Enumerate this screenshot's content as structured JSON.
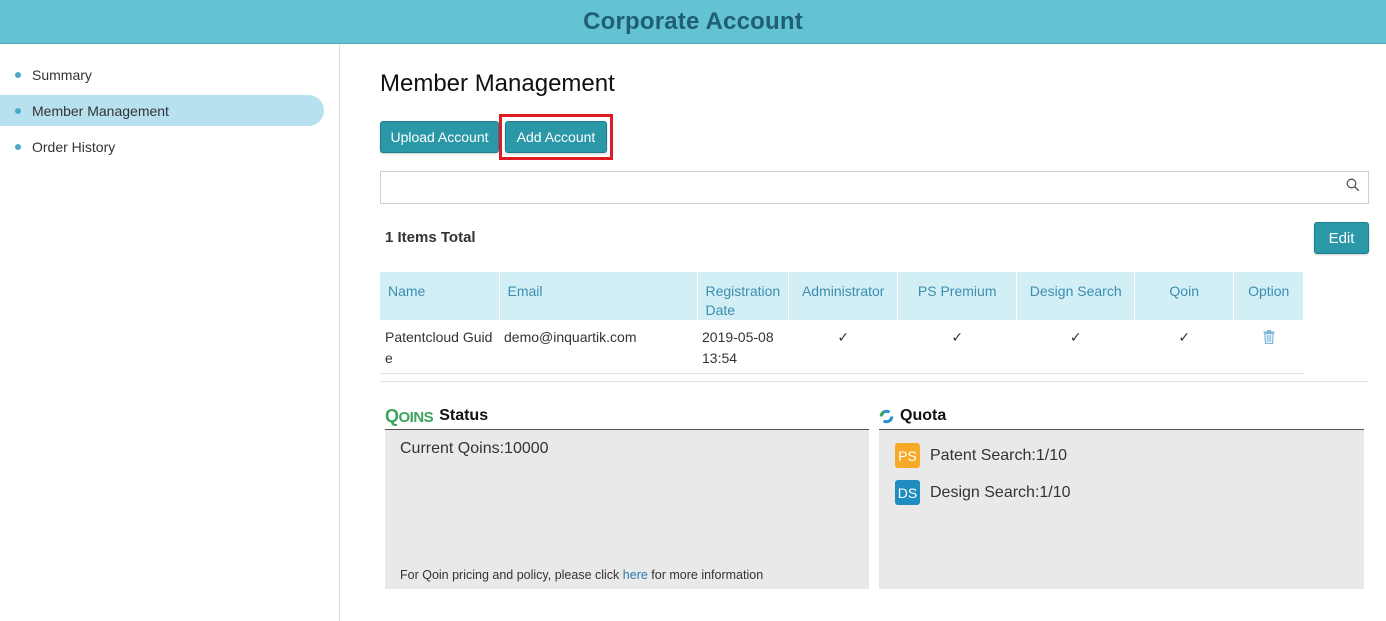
{
  "header": {
    "title": "Corporate Account"
  },
  "sidebar": {
    "items": [
      {
        "label": "Summary"
      },
      {
        "label": "Member Management"
      },
      {
        "label": "Order History"
      }
    ]
  },
  "main": {
    "title": "Member Management",
    "buttons": {
      "upload": "Upload Account",
      "add": "Add Account",
      "edit": "Edit"
    },
    "search": {
      "value": "",
      "placeholder": ""
    },
    "total": "1 Items Total",
    "table": {
      "columns": [
        "Name",
        "Email",
        "Registration Date",
        "Administrator",
        "PS Premium",
        "Design Search",
        "Qoin",
        "Option"
      ],
      "rows": [
        {
          "name": "Patentcloud Guide",
          "email": "demo@inquartik.com",
          "date": "2019-05-08",
          "time": "13:54",
          "administrator": "✓",
          "ps_premium": "✓",
          "design_search": "✓",
          "qoin": "✓"
        }
      ]
    }
  },
  "status": {
    "logo": "QOINS",
    "heading": "Status",
    "current": "Current Qoins:10000",
    "footer_before": "For Qoin pricing and policy, please click ",
    "footer_link": "here",
    "footer_after": " for more information"
  },
  "quota": {
    "heading": "Quota",
    "items": [
      {
        "badge": "PS",
        "label": "Patent Search:1/10",
        "color": "#f7a928"
      },
      {
        "badge": "DS",
        "label": "Design Search:1/10",
        "color": "#1f8dbf"
      }
    ]
  },
  "colors": {
    "header": "#63c3d2",
    "accent": "#2b98a8",
    "highlight": "#e01b24"
  }
}
